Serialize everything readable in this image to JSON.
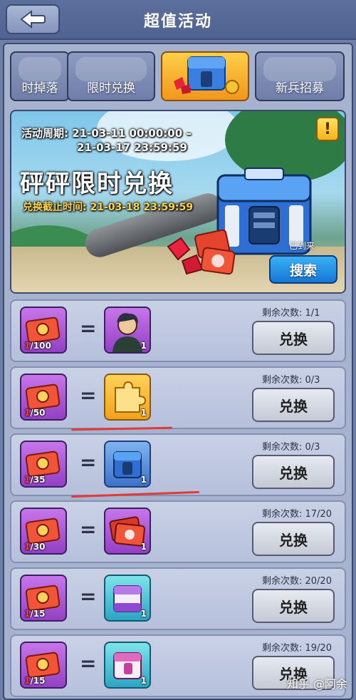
{
  "header": {
    "title": "超值活动"
  },
  "tabs": [
    {
      "label": "时掉落",
      "active": false
    },
    {
      "label": "限时兑换",
      "active": false
    },
    {
      "label": "",
      "active": true
    },
    {
      "label": "新兵招募",
      "active": false
    }
  ],
  "banner": {
    "period_label": "活动周期: 21-03-11 00:00:00 –",
    "period_end": "21-03-17 23:59:59",
    "event_title": "砰砰限时兑换",
    "exchange_deadline": "兑换截止时间: 21-03-18 23:59:59",
    "owned_label": "已到来",
    "search_button": "搜索",
    "info_icon": "!"
  },
  "rows": [
    {
      "cost_owned": "1",
      "cost_required": "/100",
      "reward_count": "1",
      "remaining": "剩余次数: 1/1",
      "button": "兑换",
      "reward_type": "character"
    },
    {
      "cost_owned": "1",
      "cost_required": "/50",
      "reward_count": "1",
      "remaining": "剩余次数: 0/3",
      "button": "兑换",
      "reward_type": "puzzle"
    },
    {
      "cost_owned": "1",
      "cost_required": "/35",
      "reward_count": "1",
      "remaining": "剩余次数: 0/3",
      "button": "兑换",
      "reward_type": "blue-chest"
    },
    {
      "cost_owned": "1",
      "cost_required": "/30",
      "reward_count": "1",
      "remaining": "剩余次数: 17/20",
      "button": "兑换",
      "reward_type": "tickets"
    },
    {
      "cost_owned": "1",
      "cost_required": "/15",
      "reward_count": "1",
      "remaining": "剩余次数: 20/20",
      "button": "兑换",
      "reward_type": "purple-chest"
    },
    {
      "cost_owned": "1",
      "cost_required": "/15",
      "reward_count": "1",
      "remaining": "剩余次数: 19/20",
      "button": "兑换",
      "reward_type": "pink-chest"
    }
  ],
  "watermark": "知乎 @阿余",
  "colors": {
    "accent_orange": "#f0961b",
    "item_purple": "#9340c4",
    "underline_red": "#e23a36",
    "button_blue": "#1677d6"
  }
}
